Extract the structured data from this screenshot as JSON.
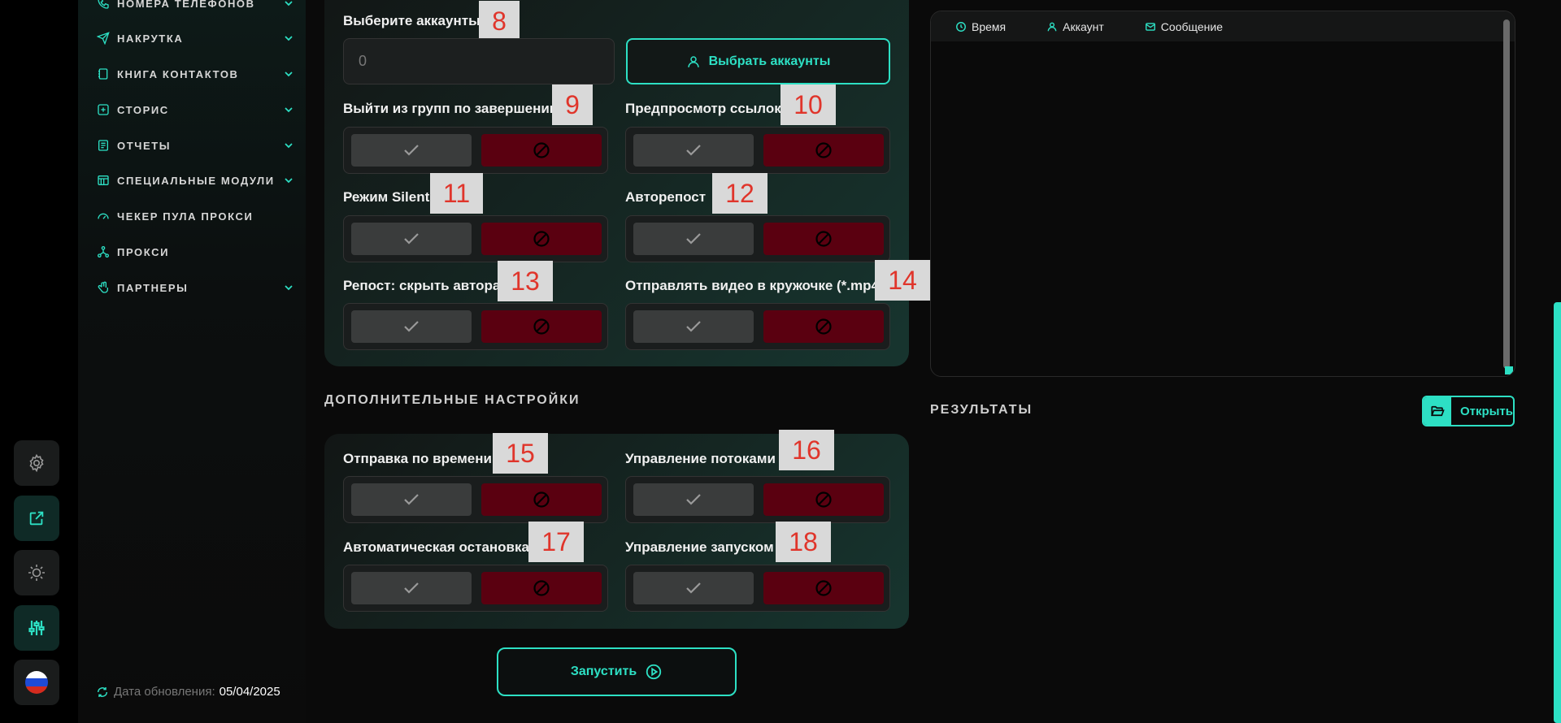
{
  "sidebar": {
    "items": [
      {
        "label": "НОМЕРА ТЕЛЕФОНОВ",
        "icon": "phone-icon",
        "expandable": true
      },
      {
        "label": "НАКРУТКА",
        "icon": "paper-plane-icon",
        "expandable": true
      },
      {
        "label": "КНИГА КОНТАКТОВ",
        "icon": "contact-book-icon",
        "expandable": true
      },
      {
        "label": "СТОРИС",
        "icon": "plus-square-icon",
        "expandable": true
      },
      {
        "label": "ОТЧЕТЫ",
        "icon": "report-icon",
        "expandable": true
      },
      {
        "label": "СПЕЦИАЛЬНЫЕ МОДУЛИ",
        "icon": "modules-icon",
        "expandable": true
      },
      {
        "label": "ЧЕКЕР ПУЛА ПРОКСИ",
        "icon": "gauge-icon",
        "expandable": false
      },
      {
        "label": "ПРОКСИ",
        "icon": "network-icon",
        "expandable": false
      },
      {
        "label": "ПАРТНЕРЫ",
        "icon": "hand-icon",
        "expandable": true
      }
    ],
    "update_label": "Дата обновления:",
    "update_value": "05/04/2025"
  },
  "rail": {
    "items": [
      "gear-icon",
      "external-link-icon",
      "sun-icon",
      "sliders-icon",
      "russia-flag-icon"
    ]
  },
  "main": {
    "accounts": {
      "label": "Выберите аккаунты",
      "badge": "8",
      "value": "0",
      "button_label": "Выбрать аккаунты"
    },
    "options": [
      {
        "label": "Выйти из групп по завершении",
        "badge": "9"
      },
      {
        "label": "Предпросмотр ссылок",
        "badge": "10"
      },
      {
        "label": "Режим Silent",
        "badge": "11"
      },
      {
        "label": "Авторепост",
        "badge": "12"
      },
      {
        "label": "Репост: скрыть автора",
        "badge": "13"
      },
      {
        "label": "Отправлять видео в кружочке (*.mp4)",
        "badge": "14"
      }
    ],
    "extra_title": "ДОПОЛНИТЕЛЬНЫЕ НАСТРОЙКИ",
    "extra_options": [
      {
        "label": "Отправка по времени",
        "badge": "15"
      },
      {
        "label": "Управление потоками",
        "badge": "16"
      },
      {
        "label": "Автоматическая остановка",
        "badge": "17"
      },
      {
        "label": "Управление запуском",
        "badge": "18"
      }
    ],
    "start_label": "Запустить"
  },
  "log": {
    "columns": [
      "Время",
      "Аккаунт",
      "Сообщение"
    ]
  },
  "results": {
    "title": "РЕЗУЛЬТАТЫ",
    "open_label": "Открыть"
  },
  "colors": {
    "accent": "#2de0c4",
    "danger": "#5a0010",
    "badge_text": "#e0352b"
  }
}
